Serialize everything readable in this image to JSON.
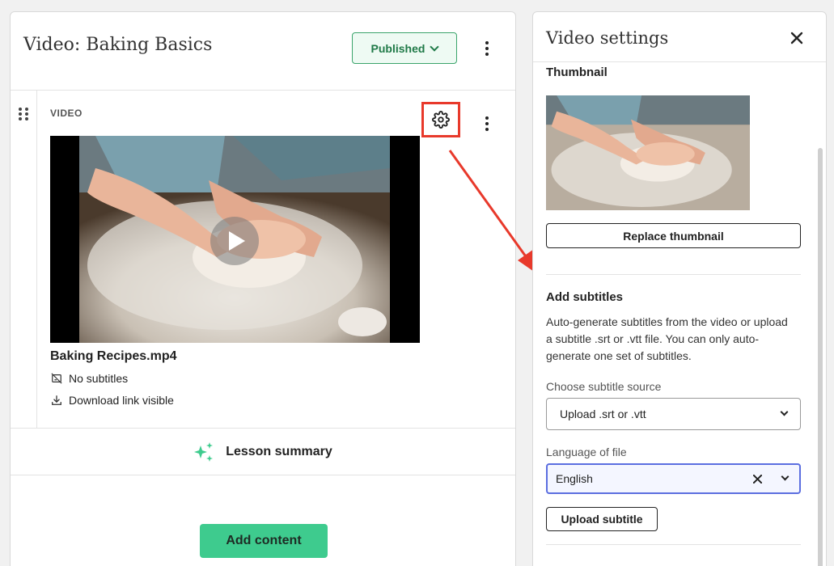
{
  "lesson": {
    "title": "Video: Baking Basics",
    "status": "Published"
  },
  "video_block": {
    "label": "VIDEO",
    "file_name": "Baking Recipes.mp4",
    "subtitles_status": "No subtitles",
    "download_status": "Download link visible"
  },
  "summary": {
    "label": "Lesson summary"
  },
  "add_content": {
    "label": "Add content"
  },
  "settings": {
    "title": "Video settings",
    "thumbnail_heading": "Thumbnail",
    "replace_thumbnail": "Replace thumbnail",
    "subtitles_heading": "Add subtitles",
    "subtitles_description": "Auto-generate subtitles from the video or upload a subtitle .srt or .vtt file. You can only auto-generate one set of subtitles.",
    "source_label": "Choose subtitle source",
    "source_value": "Upload .srt or .vtt",
    "language_label": "Language of file",
    "language_value": "English",
    "upload_button": "Upload subtitle"
  },
  "colors": {
    "published_green": "#207a48",
    "accent_green": "#3ecb8e",
    "highlight_red": "#e8392b",
    "focus_blue": "#5b6ee0"
  }
}
